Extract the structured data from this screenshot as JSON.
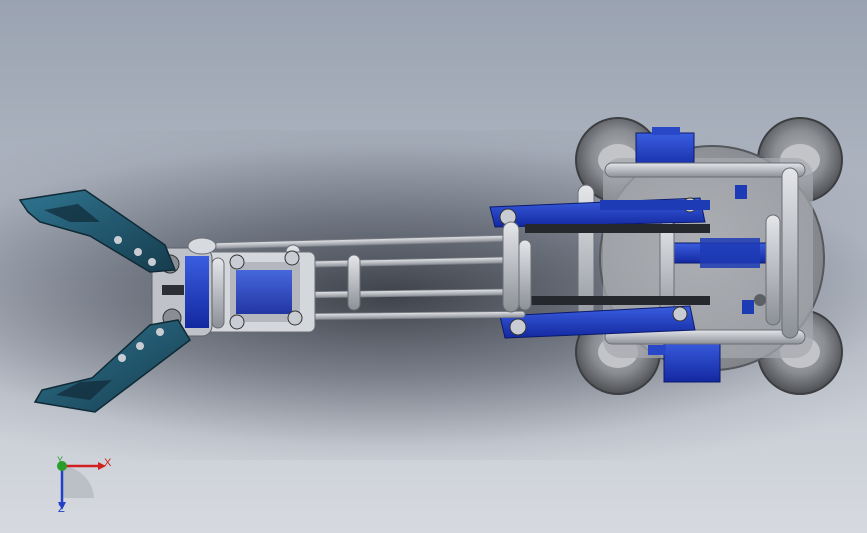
{
  "viewport": {
    "background_top": "#9aa3b1",
    "background_bottom": "#d6d9df"
  },
  "model": {
    "gripper_color": "#1f4f63",
    "link_color": "#1d3bb5",
    "metal_color": "#c9cdd3",
    "wheel_color": "#6f7278",
    "base_color": "#9a9da3"
  },
  "triad": {
    "x_label": "X",
    "y_label": "Y",
    "z_label": "Z",
    "x_color": "#d02020",
    "y_color": "#2a9d2a",
    "z_color": "#2040c8"
  }
}
